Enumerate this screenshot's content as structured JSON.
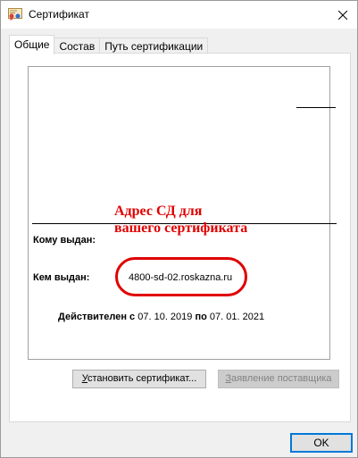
{
  "window": {
    "title": "Сертификат",
    "close_symbol": "✕"
  },
  "tabs": [
    {
      "label": "Общие",
      "active": true
    },
    {
      "label": "Состав",
      "active": false
    },
    {
      "label": "Путь сертификации",
      "active": false
    }
  ],
  "certificate": {
    "issued_to_label": "Кому выдан:",
    "issued_to_value": "",
    "issued_by_label": "Кем выдан:",
    "issued_by_value": "4800-sd-02.roskazna.ru",
    "valid_from_label": "Действителен с",
    "valid_from": "07. 10. 2019",
    "valid_to_label": "по",
    "valid_to": "07. 01. 2021"
  },
  "annotation": {
    "line1": "Адрес СД для",
    "line2": "вашего сертификата",
    "color": "#e00000"
  },
  "buttons": {
    "install_first": "У",
    "install_rest": "становить сертификат...",
    "issuer_statement_first": "З",
    "issuer_statement_rest": "аявление поставщика",
    "ok": "OK"
  },
  "icons": {
    "title": "certificate-icon",
    "close": "close-icon"
  },
  "colors": {
    "accent": "#0078d7",
    "annotation_red": "#e00000"
  }
}
